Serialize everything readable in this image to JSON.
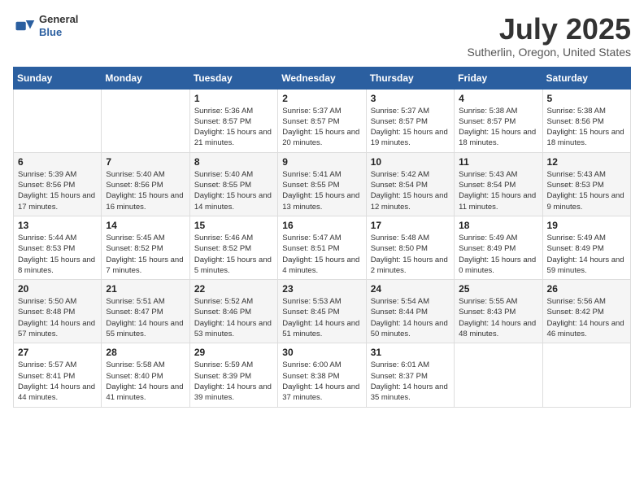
{
  "logo": {
    "line1": "General",
    "line2": "Blue"
  },
  "title": "July 2025",
  "subtitle": "Sutherlin, Oregon, United States",
  "weekdays": [
    "Sunday",
    "Monday",
    "Tuesday",
    "Wednesday",
    "Thursday",
    "Friday",
    "Saturday"
  ],
  "weeks": [
    [
      {
        "day": "",
        "info": ""
      },
      {
        "day": "",
        "info": ""
      },
      {
        "day": "1",
        "info": "Sunrise: 5:36 AM\nSunset: 8:57 PM\nDaylight: 15 hours and 21 minutes."
      },
      {
        "day": "2",
        "info": "Sunrise: 5:37 AM\nSunset: 8:57 PM\nDaylight: 15 hours and 20 minutes."
      },
      {
        "day": "3",
        "info": "Sunrise: 5:37 AM\nSunset: 8:57 PM\nDaylight: 15 hours and 19 minutes."
      },
      {
        "day": "4",
        "info": "Sunrise: 5:38 AM\nSunset: 8:57 PM\nDaylight: 15 hours and 18 minutes."
      },
      {
        "day": "5",
        "info": "Sunrise: 5:38 AM\nSunset: 8:56 PM\nDaylight: 15 hours and 18 minutes."
      }
    ],
    [
      {
        "day": "6",
        "info": "Sunrise: 5:39 AM\nSunset: 8:56 PM\nDaylight: 15 hours and 17 minutes."
      },
      {
        "day": "7",
        "info": "Sunrise: 5:40 AM\nSunset: 8:56 PM\nDaylight: 15 hours and 16 minutes."
      },
      {
        "day": "8",
        "info": "Sunrise: 5:40 AM\nSunset: 8:55 PM\nDaylight: 15 hours and 14 minutes."
      },
      {
        "day": "9",
        "info": "Sunrise: 5:41 AM\nSunset: 8:55 PM\nDaylight: 15 hours and 13 minutes."
      },
      {
        "day": "10",
        "info": "Sunrise: 5:42 AM\nSunset: 8:54 PM\nDaylight: 15 hours and 12 minutes."
      },
      {
        "day": "11",
        "info": "Sunrise: 5:43 AM\nSunset: 8:54 PM\nDaylight: 15 hours and 11 minutes."
      },
      {
        "day": "12",
        "info": "Sunrise: 5:43 AM\nSunset: 8:53 PM\nDaylight: 15 hours and 9 minutes."
      }
    ],
    [
      {
        "day": "13",
        "info": "Sunrise: 5:44 AM\nSunset: 8:53 PM\nDaylight: 15 hours and 8 minutes."
      },
      {
        "day": "14",
        "info": "Sunrise: 5:45 AM\nSunset: 8:52 PM\nDaylight: 15 hours and 7 minutes."
      },
      {
        "day": "15",
        "info": "Sunrise: 5:46 AM\nSunset: 8:52 PM\nDaylight: 15 hours and 5 minutes."
      },
      {
        "day": "16",
        "info": "Sunrise: 5:47 AM\nSunset: 8:51 PM\nDaylight: 15 hours and 4 minutes."
      },
      {
        "day": "17",
        "info": "Sunrise: 5:48 AM\nSunset: 8:50 PM\nDaylight: 15 hours and 2 minutes."
      },
      {
        "day": "18",
        "info": "Sunrise: 5:49 AM\nSunset: 8:49 PM\nDaylight: 15 hours and 0 minutes."
      },
      {
        "day": "19",
        "info": "Sunrise: 5:49 AM\nSunset: 8:49 PM\nDaylight: 14 hours and 59 minutes."
      }
    ],
    [
      {
        "day": "20",
        "info": "Sunrise: 5:50 AM\nSunset: 8:48 PM\nDaylight: 14 hours and 57 minutes."
      },
      {
        "day": "21",
        "info": "Sunrise: 5:51 AM\nSunset: 8:47 PM\nDaylight: 14 hours and 55 minutes."
      },
      {
        "day": "22",
        "info": "Sunrise: 5:52 AM\nSunset: 8:46 PM\nDaylight: 14 hours and 53 minutes."
      },
      {
        "day": "23",
        "info": "Sunrise: 5:53 AM\nSunset: 8:45 PM\nDaylight: 14 hours and 51 minutes."
      },
      {
        "day": "24",
        "info": "Sunrise: 5:54 AM\nSunset: 8:44 PM\nDaylight: 14 hours and 50 minutes."
      },
      {
        "day": "25",
        "info": "Sunrise: 5:55 AM\nSunset: 8:43 PM\nDaylight: 14 hours and 48 minutes."
      },
      {
        "day": "26",
        "info": "Sunrise: 5:56 AM\nSunset: 8:42 PM\nDaylight: 14 hours and 46 minutes."
      }
    ],
    [
      {
        "day": "27",
        "info": "Sunrise: 5:57 AM\nSunset: 8:41 PM\nDaylight: 14 hours and 44 minutes."
      },
      {
        "day": "28",
        "info": "Sunrise: 5:58 AM\nSunset: 8:40 PM\nDaylight: 14 hours and 41 minutes."
      },
      {
        "day": "29",
        "info": "Sunrise: 5:59 AM\nSunset: 8:39 PM\nDaylight: 14 hours and 39 minutes."
      },
      {
        "day": "30",
        "info": "Sunrise: 6:00 AM\nSunset: 8:38 PM\nDaylight: 14 hours and 37 minutes."
      },
      {
        "day": "31",
        "info": "Sunrise: 6:01 AM\nSunset: 8:37 PM\nDaylight: 14 hours and 35 minutes."
      },
      {
        "day": "",
        "info": ""
      },
      {
        "day": "",
        "info": ""
      }
    ]
  ]
}
